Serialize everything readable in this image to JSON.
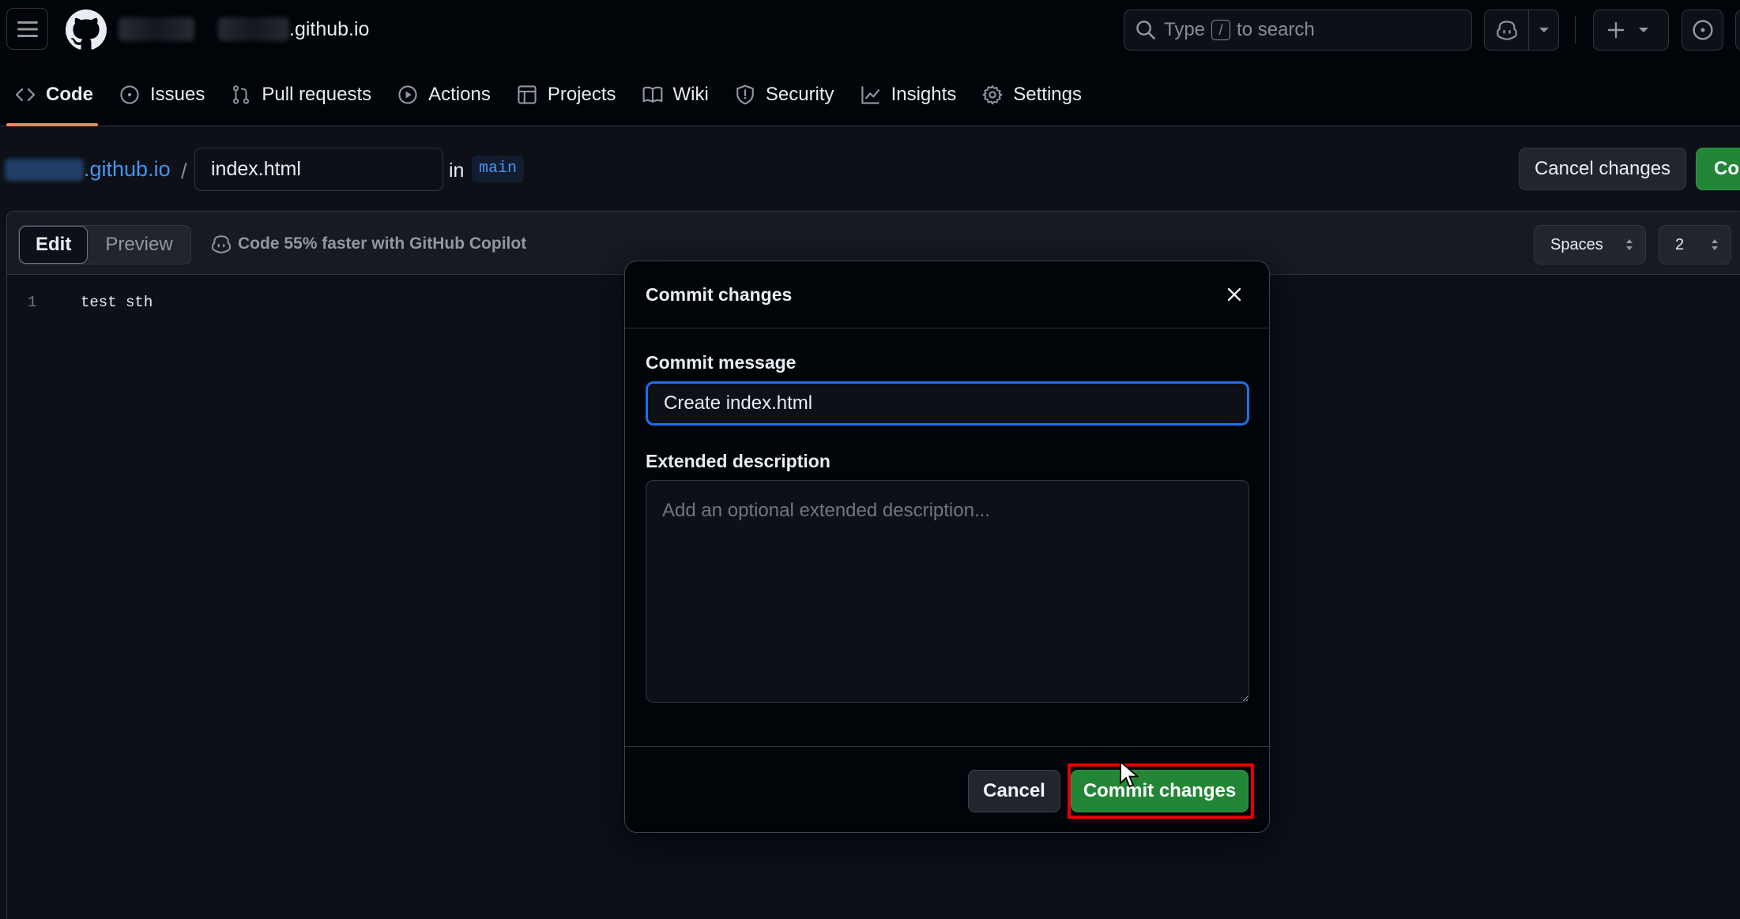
{
  "header": {
    "repo_suffix": ".github.io",
    "search_prefix": "Type",
    "search_key": "/",
    "search_suffix": "to search"
  },
  "repo_nav": {
    "items": [
      {
        "label": "Code",
        "icon": "code-icon",
        "active": true
      },
      {
        "label": "Issues",
        "icon": "issue-opened-icon"
      },
      {
        "label": "Pull requests",
        "icon": "git-pull-request-icon"
      },
      {
        "label": "Actions",
        "icon": "play-icon"
      },
      {
        "label": "Projects",
        "icon": "table-icon"
      },
      {
        "label": "Wiki",
        "icon": "book-icon"
      },
      {
        "label": "Security",
        "icon": "shield-icon"
      },
      {
        "label": "Insights",
        "icon": "graph-icon"
      },
      {
        "label": "Settings",
        "icon": "gear-icon"
      }
    ]
  },
  "pathbar": {
    "repo_suffix": ".github.io",
    "separator": "/",
    "filename": "index.html",
    "in_label": "in",
    "branch": "main",
    "cancel_label": "Cancel changes",
    "commit_label_visible": "Co"
  },
  "editor": {
    "tab_edit": "Edit",
    "tab_preview": "Preview",
    "copilot_tip": "Code 55% faster with GitHub Copilot",
    "indent_mode": "Spaces",
    "indent_size": "2",
    "lines": [
      {
        "number": "1",
        "text": "test sth"
      }
    ]
  },
  "modal": {
    "title": "Commit changes",
    "commit_message_label": "Commit message",
    "commit_message_value": "Create index.html",
    "extended_label": "Extended description",
    "extended_placeholder": "Add an optional extended description...",
    "cancel_label": "Cancel",
    "commit_label": "Commit changes"
  },
  "colors": {
    "accent_blue": "#4493f8",
    "primary_green": "#238636",
    "highlight_red": "#e60000",
    "active_tab_underline": "#f78166"
  }
}
